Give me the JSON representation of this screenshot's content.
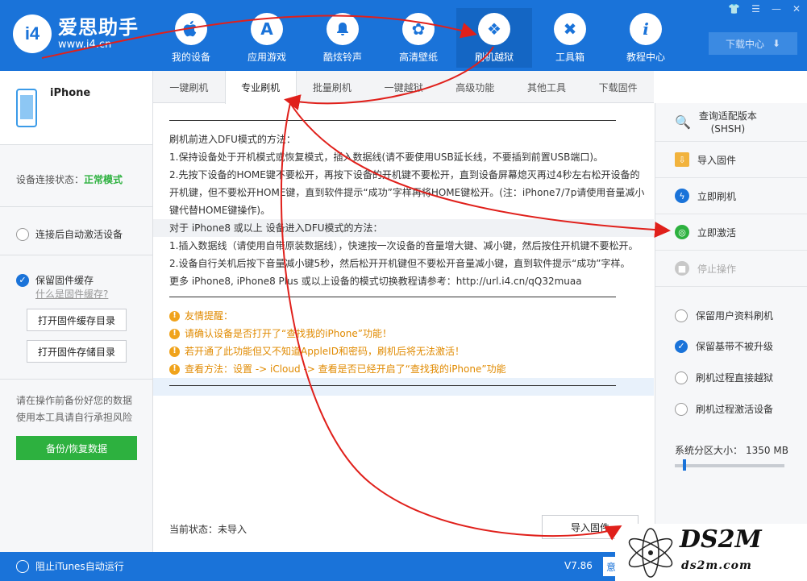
{
  "app": {
    "logo_badge": "i4",
    "name": "爱思助手",
    "url": "www.i4.cn"
  },
  "nav": [
    {
      "label": "我的设备",
      "icon": "apple-icon",
      "glyph": ""
    },
    {
      "label": "应用游戏",
      "icon": "appstore-icon",
      "glyph": "A"
    },
    {
      "label": "酷炫铃声",
      "icon": "bell-icon",
      "glyph": "🔔"
    },
    {
      "label": "高清壁纸",
      "icon": "flower-icon",
      "glyph": "✿"
    },
    {
      "label": "刷机越狱",
      "icon": "dropbox-icon",
      "glyph": "❖"
    },
    {
      "label": "工具箱",
      "icon": "tools-icon",
      "glyph": "✖"
    },
    {
      "label": "教程中心",
      "icon": "info-icon",
      "glyph": "i"
    }
  ],
  "window_controls": [
    "👕",
    "☰",
    "—",
    "✕"
  ],
  "download_center": {
    "label": "下载中心",
    "icon": "download-icon",
    "glyph": "⬇"
  },
  "sidebar": {
    "device_name": "iPhone",
    "conn_label": "设备连接状态：",
    "conn_value": "正常模式",
    "auto_activate": "连接后自动激活设备",
    "keep_cache": "保留固件缓存",
    "what_cache": "什么是固件缓存?",
    "open_cache_dir": "打开固件缓存目录",
    "open_store_dir": "打开固件存储目录",
    "backup_tip_1": "请在操作前备份好您的数据",
    "backup_tip_2": "使用本工具请自行承担风险",
    "backup_button": "备份/恢复数据"
  },
  "tabs": [
    "一键刷机",
    "专业刷机",
    "批量刷机",
    "一键越狱",
    "高级功能",
    "其他工具",
    "下载固件"
  ],
  "active_tab_index": 1,
  "content": {
    "lines": [
      "刷机前进入DFU模式的方法：",
      "1.保持设备处于开机模式或恢复模式，插入数据线(请不要使用USB延长线，不要插到前置USB端口)。",
      "2.先按下设备的HOME键不要松开，再按下设备的开机键不要松开，直到设备屏幕熄灭再过4秒左右松开设备的",
      "开机键，但不要松开HOME键，直到软件提示“成功”字样再将HOME键松开。(注：iPhone7/7p请使用音量减小",
      "键代替HOME键操作)。",
      "对于 iPhone8 或以上 设备进入DFU模式的方法：",
      "1.插入数据线（请使用自带原装数据线），快速按一次设备的音量增大键、减小键，然后按住开机键不要松开。",
      "2.设备自行关机后按下音量减小键5秒，然后松开开机键但不要松开音量减小键，直到软件提示“成功”字样。",
      "更多 iPhone8, iPhone8 Plus 或以上设备的模式切换教程请参考：http://url.i4.cn/qQ32muaa"
    ],
    "warnings": [
      "友情提醒：",
      "请确认设备是否打开了“查找我的iPhone”功能！",
      "若开通了此功能但又不知道AppleID和密码，刷机后将无法激活！",
      "查看方法：设置 -> iCloud -> 查看是否已经开启了“查找我的iPhone”功能"
    ]
  },
  "status": {
    "label": "当前状态：未导入",
    "import_button": "导入固件"
  },
  "right_panel": {
    "actions": [
      {
        "label_1": "查询适配版本",
        "label_2": "(SHSH)",
        "icon": "search-shsh-icon",
        "color": "#555555"
      },
      {
        "label_1": "导入固件",
        "label_2": "",
        "icon": "import-folder-icon",
        "color": "#f2b33d"
      },
      {
        "label_1": "立即刷机",
        "label_2": "",
        "icon": "flash-icon",
        "color": "#1a73d9"
      },
      {
        "label_1": "立即激活",
        "label_2": "",
        "icon": "globe-icon",
        "color": "#2db13f"
      },
      {
        "label_1": "停止操作",
        "label_2": "",
        "icon": "stop-icon",
        "color": "#c8c8c8"
      }
    ],
    "options": [
      {
        "label": "保留用户资料刷机",
        "checked": false
      },
      {
        "label": "保留基带不被升级",
        "checked": true
      },
      {
        "label": "刷机过程直接越狱",
        "checked": false
      },
      {
        "label": "刷机过程激活设备",
        "checked": false
      }
    ],
    "partition_label": "系统分区大小：",
    "partition_value": "1350 MB",
    "partition_fraction": 0.07
  },
  "bottom": {
    "itunes": "阻止iTunes自动运行",
    "version": "V7.86",
    "feedback": "意"
  },
  "watermark": {
    "main": "DS2M",
    "sub": "ds2m.com"
  },
  "colors": {
    "brand_blue": "#1a73d9",
    "green": "#2db13f",
    "warning": "#e08a00",
    "arrow_red": "#e0201b"
  }
}
